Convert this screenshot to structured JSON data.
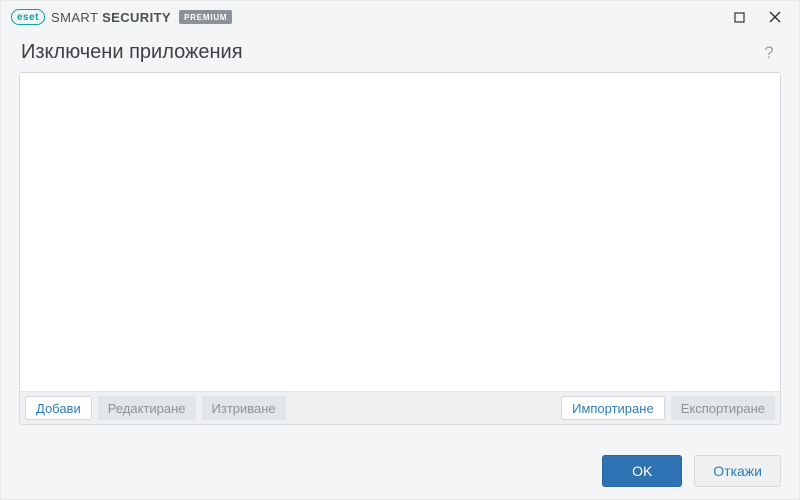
{
  "titlebar": {
    "brand_pill": "eset",
    "brand_text_light": "SMART",
    "brand_text_bold": "SECURITY",
    "brand_tag": "PREMIUM"
  },
  "page": {
    "title": "Изключени приложения"
  },
  "toolbar": {
    "add": "Добави",
    "edit": "Редактиране",
    "delete": "Изтриване",
    "import": "Импортиране",
    "export": "Експортиране"
  },
  "footer": {
    "ok": "OK",
    "cancel": "Откажи"
  },
  "list": {
    "items": []
  }
}
